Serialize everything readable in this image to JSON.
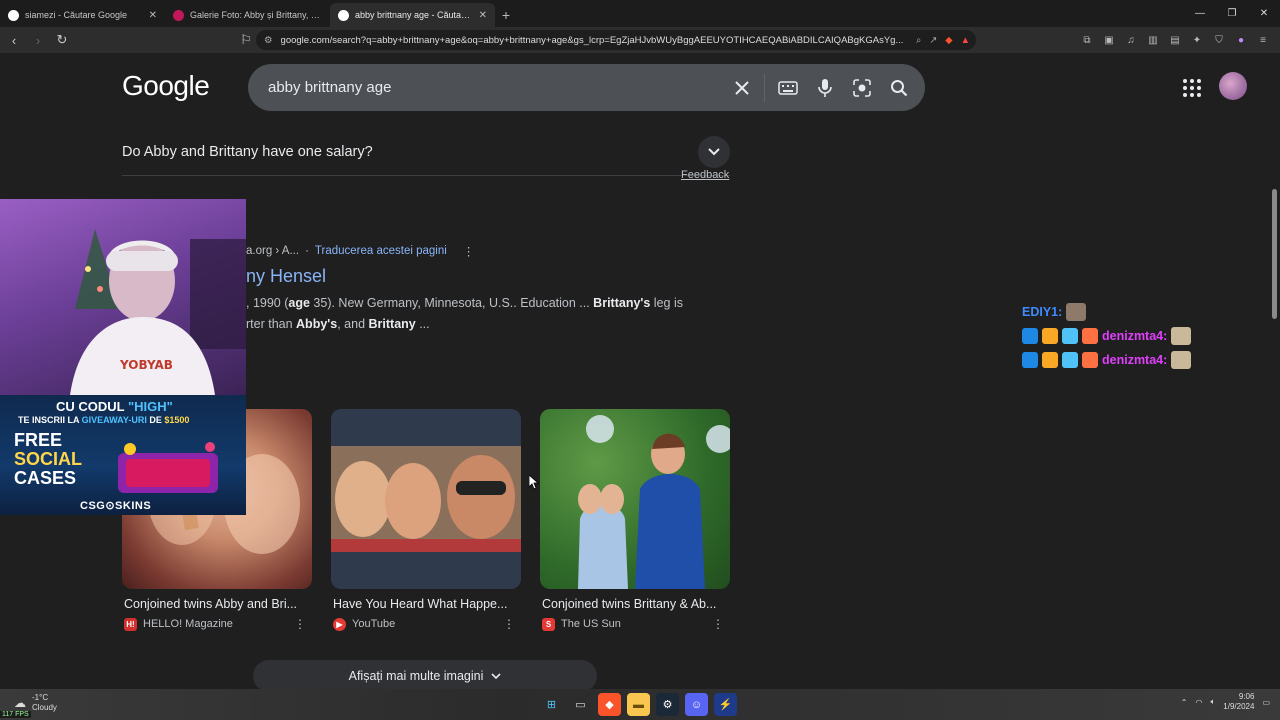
{
  "browser": {
    "tabs": [
      {
        "title": "siamezi - Căutare Google",
        "favcolor": "#ffffff"
      },
      {
        "title": "Galerie Foto: Abby și Brittany, gemen",
        "favcolor": "#c2185b"
      },
      {
        "title": "abby brittnany age - Căutare Go",
        "favcolor": "#ffffff"
      }
    ],
    "url": "google.com/search?q=abby+brittnany+age&oq=abby+brittnany+age&gs_lcrp=EgZjaHJvbWUyBggAEEUYOTIHCAEQABiABDILCAIQABgKGAsYg..."
  },
  "google": {
    "logo": "Google",
    "query": "abby brittnany age",
    "paa_question": "Do Abby and Brittany have one salary?",
    "feedback": "Feedback",
    "result": {
      "cite": "a.org › A...",
      "translate": "Traducerea acestei pagini",
      "title": "ny Hensel",
      "snippet_1a": ", 1990 (",
      "snippet_1b": "age",
      "snippet_1c": " 35). New Germany, Minnesota, U.S.. Education ... ",
      "snippet_1d": "Brittany's",
      "snippet_1e": " leg is",
      "snippet_2a": "rter than ",
      "snippet_2b": "Abby's",
      "snippet_2c": ", and ",
      "snippet_2d": "Brittany",
      "snippet_2e": " ..."
    },
    "cards": [
      {
        "title": "Conjoined twins Abby and Bri...",
        "source": "HELLO! Magazine",
        "badge": "H!",
        "badgecolor": "#d32f2f"
      },
      {
        "title": "Have You Heard What Happe...",
        "source": "YouTube",
        "badge": "▶",
        "badgecolor": "#e53935"
      },
      {
        "title": "Conjoined twins Brittany & Ab...",
        "source": "The US Sun",
        "badge": "S",
        "badgecolor": "#e53935"
      }
    ],
    "more_images": "Afișați mai multe imagini"
  },
  "overlay": {
    "promo_line1a": "CU CODUL ",
    "promo_line1b": "\"HIGH\"",
    "promo_line2a": "TE INSCRII LA ",
    "promo_line2b": "GIVEAWAY-URI",
    "promo_line2c": " DE ",
    "promo_line2d": "$1500",
    "promo_free": "FREE",
    "promo_social": "SOCIAL",
    "promo_cases": "CASES",
    "promo_brand": "CSG⊙SKINS",
    "chat": [
      {
        "user": "EDIY1:",
        "color": "#3d8bff"
      },
      {
        "user": "denizmta4:",
        "color": "#e040fb"
      },
      {
        "user": "denizmta4:",
        "color": "#e040fb"
      }
    ]
  },
  "taskbar": {
    "temp": "-1°C",
    "weather": "Cloudy",
    "time": "9:06",
    "date": "1/9/2024",
    "fps": "117 FPS"
  }
}
